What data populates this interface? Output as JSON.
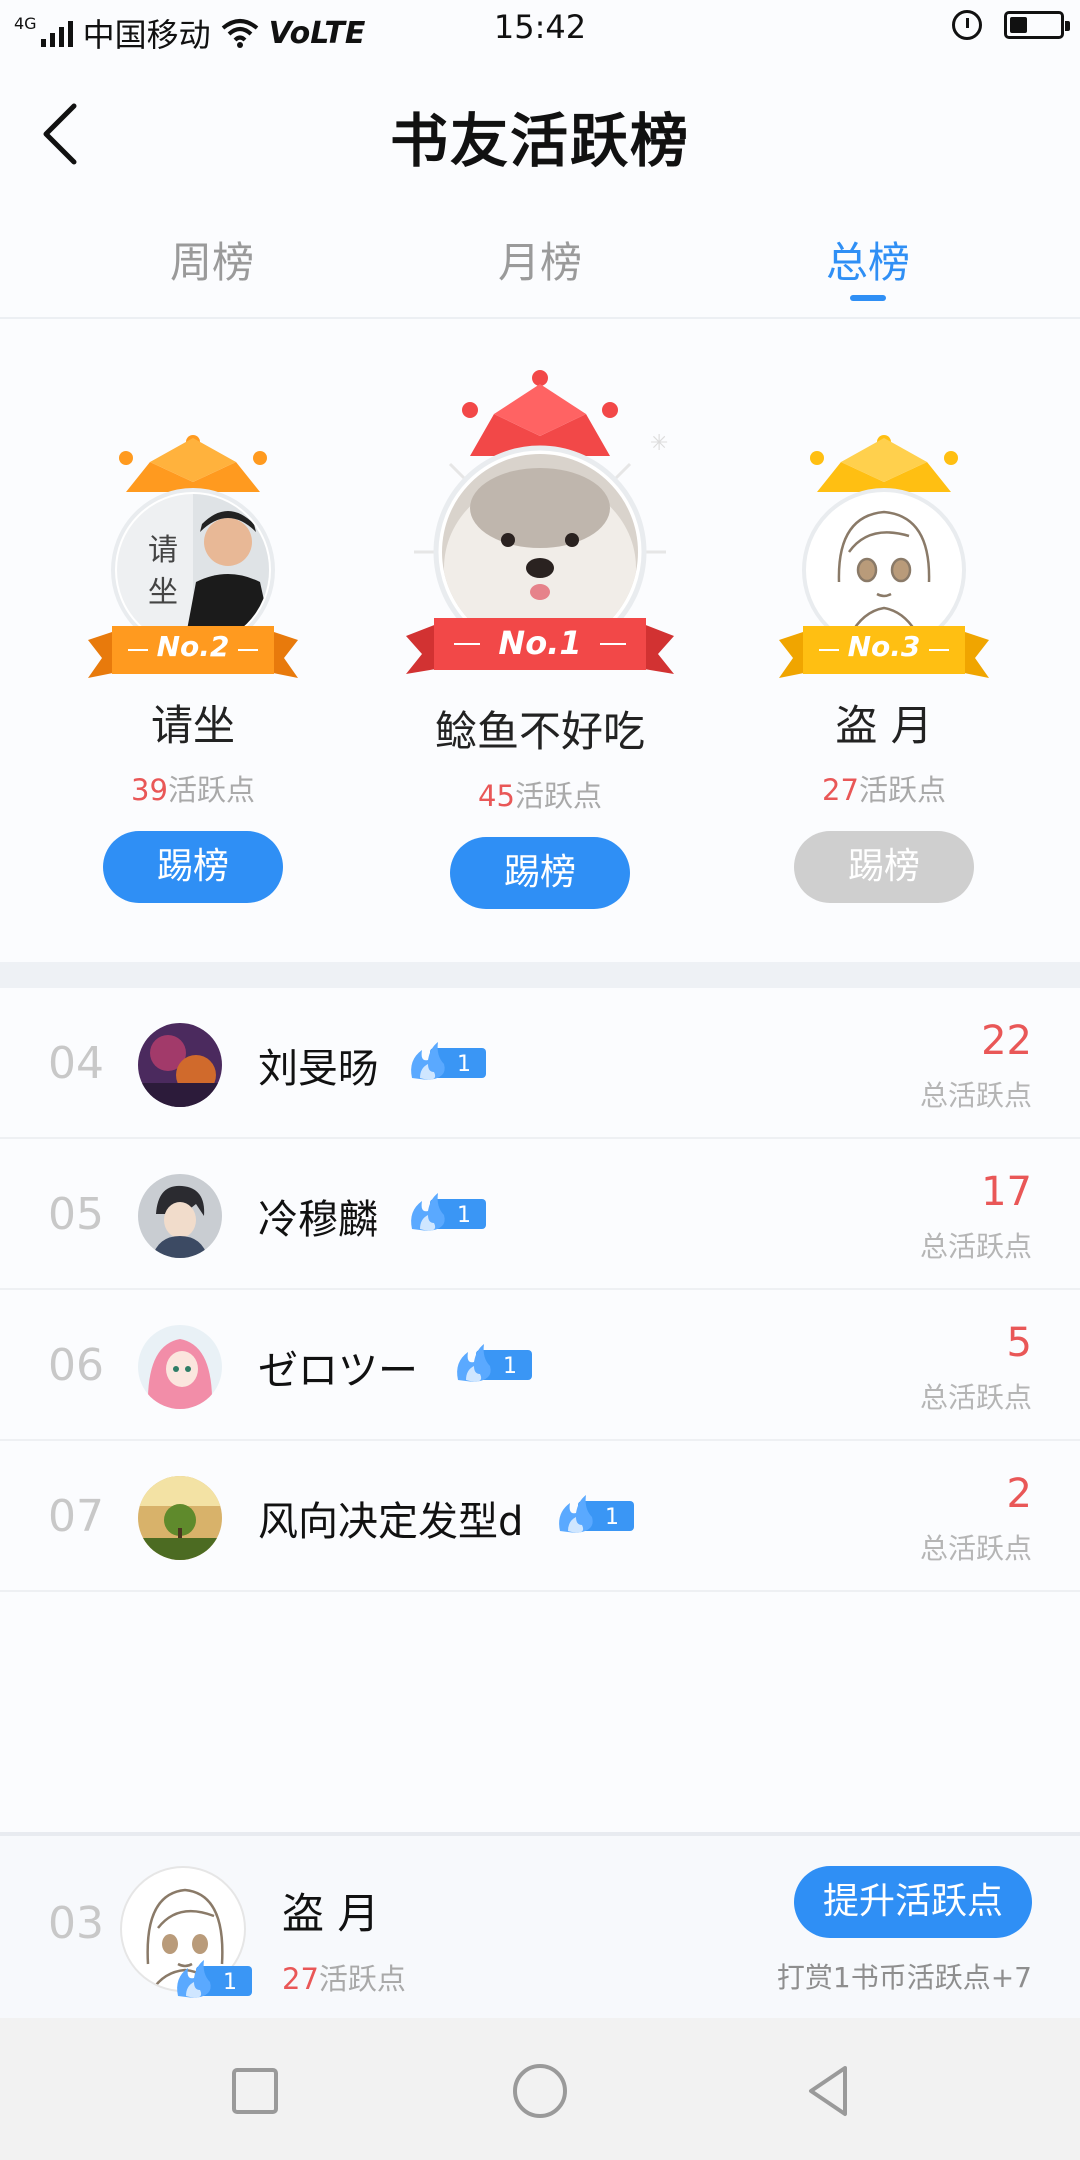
{
  "status_bar": {
    "network_tag": "4G",
    "carrier": "中国移动",
    "volte": "VoLTE",
    "time": "15:42",
    "battery_level": 0.35
  },
  "header": {
    "title": "书友活跃榜"
  },
  "tabs": [
    {
      "label": "周榜",
      "active": false
    },
    {
      "label": "月榜",
      "active": false
    },
    {
      "label": "总榜",
      "active": true
    }
  ],
  "podium": {
    "first": {
      "ribbon": "No.1",
      "name": "鲶鱼不好吃",
      "points": "45",
      "points_label": "活跃点",
      "button": "踢榜",
      "button_enabled": true,
      "crown_color": "#f24848"
    },
    "second": {
      "ribbon": "No.2",
      "name": "请坐",
      "points": "39",
      "points_label": "活跃点",
      "button": "踢榜",
      "button_enabled": true,
      "crown_color": "#ff9a1f",
      "avatar_text": [
        "请",
        "坐"
      ]
    },
    "third": {
      "ribbon": "No.3",
      "name": "盗 月",
      "points": "27",
      "points_label": "活跃点",
      "button": "踢榜",
      "button_enabled": false,
      "crown_color": "#ffbf12"
    }
  },
  "list": [
    {
      "rank": "04",
      "name": "刘旻旸",
      "level": "1",
      "score": "22",
      "score_label": "总活跃点"
    },
    {
      "rank": "05",
      "name": "冷穆麟",
      "level": "1",
      "score": "17",
      "score_label": "总活跃点"
    },
    {
      "rank": "06",
      "name": "ゼロツー",
      "level": "1",
      "score": "5",
      "score_label": "总活跃点"
    },
    {
      "rank": "07",
      "name": "风向决定发型d",
      "level": "1",
      "score": "2",
      "score_label": "总活跃点"
    }
  ],
  "me": {
    "rank": "03",
    "name": "盗 月",
    "level": "1",
    "points": "27",
    "points_label": "活跃点",
    "boost_button": "提升活跃点",
    "hint": "打赏1书币活跃点+7"
  },
  "colors": {
    "accent": "#2f8ff5",
    "score": "#e95757",
    "muted": "#b5b5b5"
  }
}
